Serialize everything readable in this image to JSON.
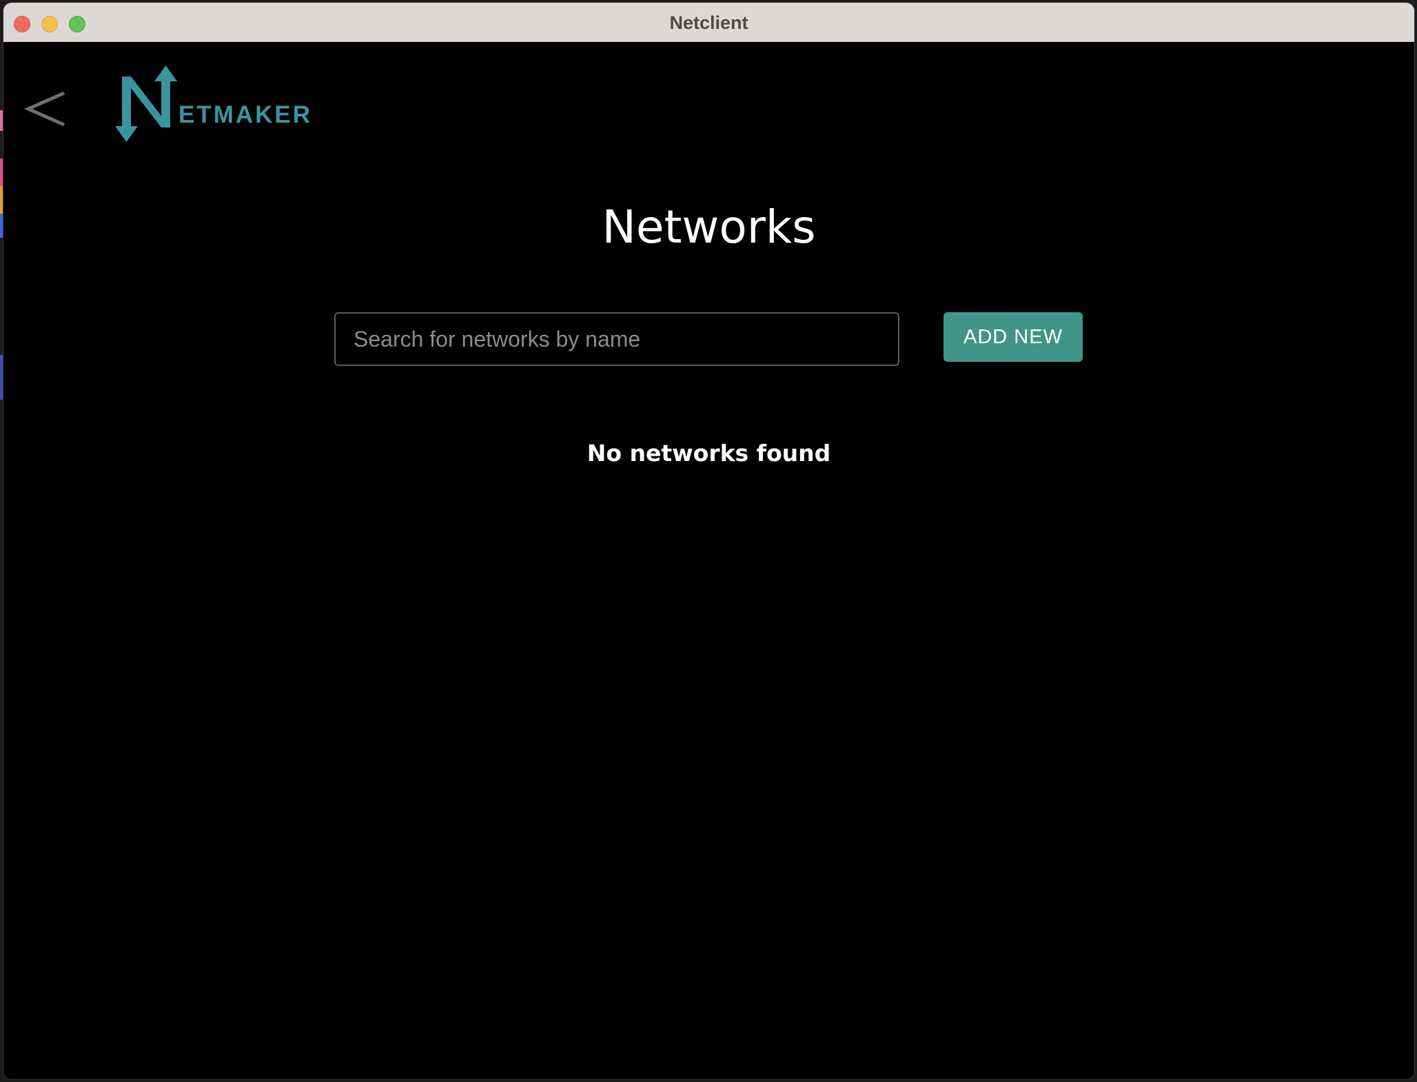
{
  "window": {
    "title": "Netclient"
  },
  "header": {
    "back_icon": "chevron-left-icon",
    "logo": {
      "letter": "N",
      "wordmark": "ETMAKER",
      "color": "#3a94a0"
    }
  },
  "main": {
    "title": "Networks",
    "search": {
      "placeholder": "Search for networks by name",
      "value": ""
    },
    "add_button_label": "ADD NEW",
    "empty_message": "No networks found"
  },
  "colors": {
    "accent": "#3f9688",
    "background": "#000000",
    "titlebar": "#dcd8d6"
  }
}
